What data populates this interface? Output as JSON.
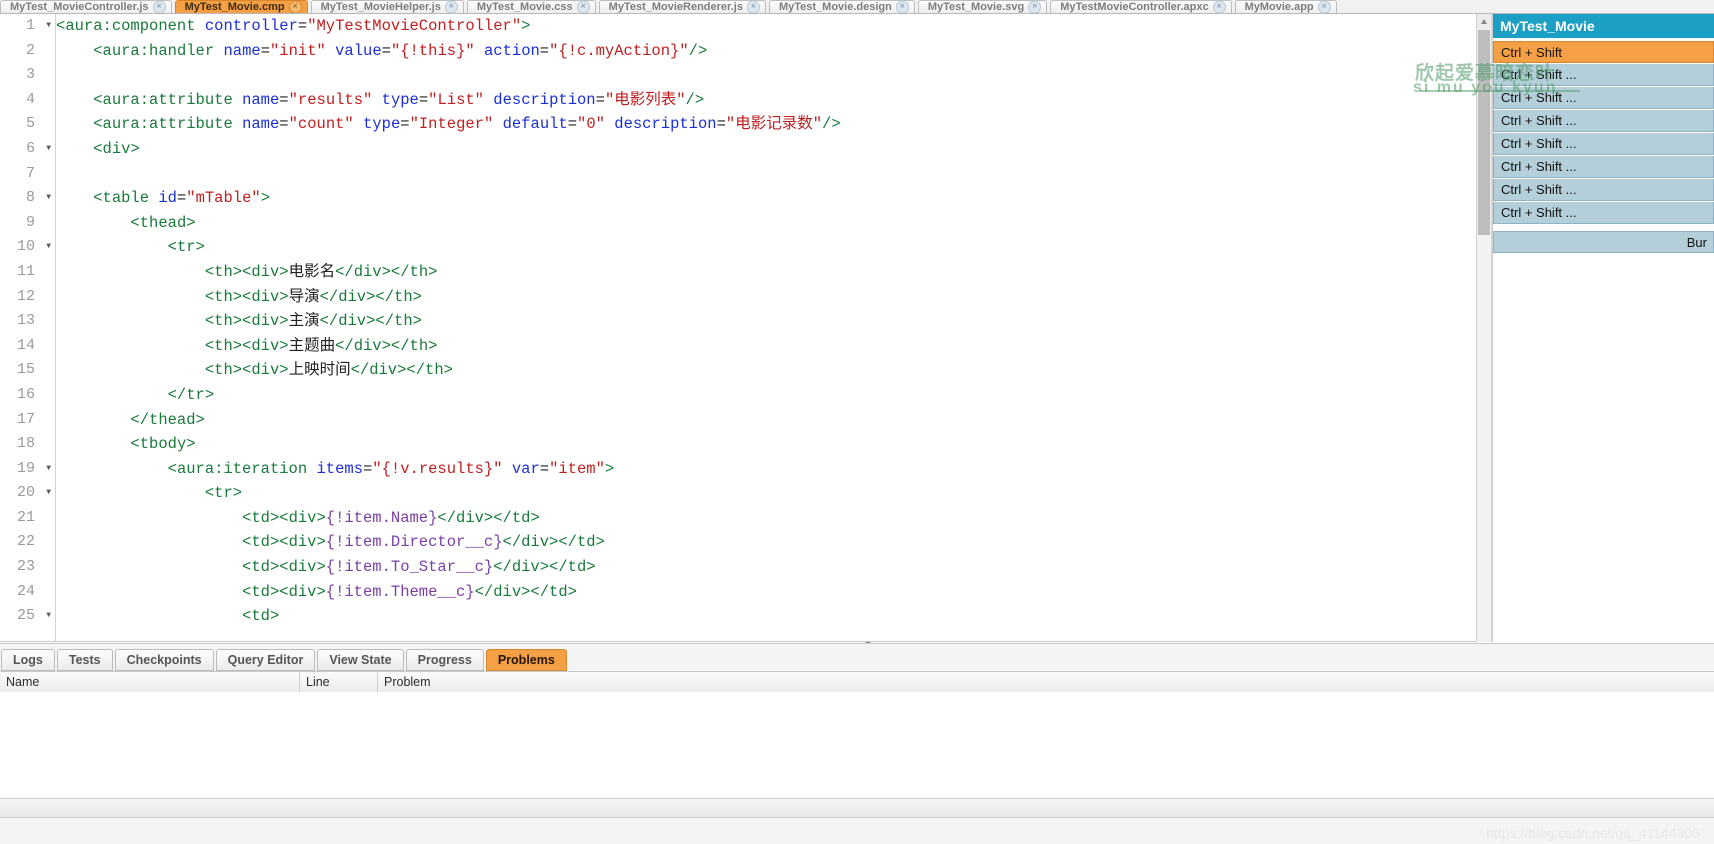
{
  "tabs": [
    {
      "label": "MyTest_MovieController.js",
      "active": false
    },
    {
      "label": "MyTest_Movie.cmp",
      "active": true
    },
    {
      "label": "MyTest_MovieHelper.js",
      "active": false
    },
    {
      "label": "MyTest_Movie.css",
      "active": false
    },
    {
      "label": "MyTest_MovieRenderer.js",
      "active": false
    },
    {
      "label": "MyTest_Movie.design",
      "active": false
    },
    {
      "label": "MyTest_Movie.svg",
      "active": false
    },
    {
      "label": "MyTestMovieController.apxc",
      "active": false
    },
    {
      "label": "MyMovie.app",
      "active": false
    }
  ],
  "tab_close_glyph": "×",
  "editor": {
    "lines": [
      {
        "n": 1,
        "fold": true,
        "indent": 0,
        "parts": [
          {
            "t": "punct",
            "s": "<"
          },
          {
            "t": "tag",
            "s": "aura:component"
          },
          {
            "t": "plain",
            "s": " "
          },
          {
            "t": "attr",
            "s": "controller"
          },
          {
            "t": "plain",
            "s": "="
          },
          {
            "t": "val",
            "s": "\"MyTestMovieController\""
          },
          {
            "t": "punct",
            "s": ">"
          }
        ]
      },
      {
        "n": 2,
        "fold": false,
        "indent": 1,
        "parts": [
          {
            "t": "punct",
            "s": "<"
          },
          {
            "t": "tag",
            "s": "aura:handler"
          },
          {
            "t": "plain",
            "s": " "
          },
          {
            "t": "attr",
            "s": "name"
          },
          {
            "t": "plain",
            "s": "="
          },
          {
            "t": "val",
            "s": "\"init\""
          },
          {
            "t": "plain",
            "s": " "
          },
          {
            "t": "attr",
            "s": "value"
          },
          {
            "t": "plain",
            "s": "="
          },
          {
            "t": "val",
            "s": "\"{!this}\""
          },
          {
            "t": "plain",
            "s": " "
          },
          {
            "t": "attr",
            "s": "action"
          },
          {
            "t": "plain",
            "s": "="
          },
          {
            "t": "val",
            "s": "\"{!c.myAction}\""
          },
          {
            "t": "punct",
            "s": "/>"
          }
        ]
      },
      {
        "n": 3,
        "fold": false,
        "indent": 0,
        "parts": []
      },
      {
        "n": 4,
        "fold": false,
        "indent": 1,
        "parts": [
          {
            "t": "punct",
            "s": "<"
          },
          {
            "t": "tag",
            "s": "aura:attribute"
          },
          {
            "t": "plain",
            "s": " "
          },
          {
            "t": "attr",
            "s": "name"
          },
          {
            "t": "plain",
            "s": "="
          },
          {
            "t": "val",
            "s": "\"results\""
          },
          {
            "t": "plain",
            "s": " "
          },
          {
            "t": "attr",
            "s": "type"
          },
          {
            "t": "plain",
            "s": "="
          },
          {
            "t": "val",
            "s": "\"List\""
          },
          {
            "t": "plain",
            "s": " "
          },
          {
            "t": "attr",
            "s": "description"
          },
          {
            "t": "plain",
            "s": "="
          },
          {
            "t": "val",
            "s": "\"电影列表\""
          },
          {
            "t": "punct",
            "s": "/>"
          }
        ]
      },
      {
        "n": 5,
        "fold": false,
        "indent": 1,
        "parts": [
          {
            "t": "punct",
            "s": "<"
          },
          {
            "t": "tag",
            "s": "aura:attribute"
          },
          {
            "t": "plain",
            "s": " "
          },
          {
            "t": "attr",
            "s": "name"
          },
          {
            "t": "plain",
            "s": "="
          },
          {
            "t": "val",
            "s": "\"count\""
          },
          {
            "t": "plain",
            "s": " "
          },
          {
            "t": "attr",
            "s": "type"
          },
          {
            "t": "plain",
            "s": "="
          },
          {
            "t": "val",
            "s": "\"Integer\""
          },
          {
            "t": "plain",
            "s": " "
          },
          {
            "t": "attr",
            "s": "default"
          },
          {
            "t": "plain",
            "s": "="
          },
          {
            "t": "val",
            "s": "\"0\""
          },
          {
            "t": "plain",
            "s": " "
          },
          {
            "t": "attr",
            "s": "description"
          },
          {
            "t": "plain",
            "s": "="
          },
          {
            "t": "val",
            "s": "\"电影记录数\""
          },
          {
            "t": "punct",
            "s": "/>"
          }
        ]
      },
      {
        "n": 6,
        "fold": true,
        "indent": 1,
        "parts": [
          {
            "t": "punct",
            "s": "<"
          },
          {
            "t": "tag",
            "s": "div"
          },
          {
            "t": "punct",
            "s": ">"
          }
        ]
      },
      {
        "n": 7,
        "fold": false,
        "indent": 0,
        "parts": []
      },
      {
        "n": 8,
        "fold": true,
        "indent": 1,
        "parts": [
          {
            "t": "punct",
            "s": "<"
          },
          {
            "t": "tag",
            "s": "table"
          },
          {
            "t": "plain",
            "s": " "
          },
          {
            "t": "attr",
            "s": "id"
          },
          {
            "t": "plain",
            "s": "="
          },
          {
            "t": "val",
            "s": "\"mTable\""
          },
          {
            "t": "punct",
            "s": ">"
          }
        ]
      },
      {
        "n": 9,
        "fold": false,
        "indent": 2,
        "parts": [
          {
            "t": "punct",
            "s": "<"
          },
          {
            "t": "tag",
            "s": "thead"
          },
          {
            "t": "punct",
            "s": ">"
          }
        ]
      },
      {
        "n": 10,
        "fold": true,
        "indent": 3,
        "parts": [
          {
            "t": "punct",
            "s": "<"
          },
          {
            "t": "tag",
            "s": "tr"
          },
          {
            "t": "punct",
            "s": ">"
          }
        ]
      },
      {
        "n": 11,
        "fold": false,
        "indent": 4,
        "parts": [
          {
            "t": "punct",
            "s": "<"
          },
          {
            "t": "tag",
            "s": "th"
          },
          {
            "t": "punct",
            "s": "><"
          },
          {
            "t": "tag",
            "s": "div"
          },
          {
            "t": "punct",
            "s": ">"
          },
          {
            "t": "plain",
            "s": "电影名"
          },
          {
            "t": "punct",
            "s": "</"
          },
          {
            "t": "tag",
            "s": "div"
          },
          {
            "t": "punct",
            "s": "></"
          },
          {
            "t": "tag",
            "s": "th"
          },
          {
            "t": "punct",
            "s": ">"
          }
        ]
      },
      {
        "n": 12,
        "fold": false,
        "indent": 4,
        "parts": [
          {
            "t": "punct",
            "s": "<"
          },
          {
            "t": "tag",
            "s": "th"
          },
          {
            "t": "punct",
            "s": "><"
          },
          {
            "t": "tag",
            "s": "div"
          },
          {
            "t": "punct",
            "s": ">"
          },
          {
            "t": "plain",
            "s": "导演"
          },
          {
            "t": "punct",
            "s": "</"
          },
          {
            "t": "tag",
            "s": "div"
          },
          {
            "t": "punct",
            "s": "></"
          },
          {
            "t": "tag",
            "s": "th"
          },
          {
            "t": "punct",
            "s": ">"
          }
        ]
      },
      {
        "n": 13,
        "fold": false,
        "indent": 4,
        "parts": [
          {
            "t": "punct",
            "s": "<"
          },
          {
            "t": "tag",
            "s": "th"
          },
          {
            "t": "punct",
            "s": "><"
          },
          {
            "t": "tag",
            "s": "div"
          },
          {
            "t": "punct",
            "s": ">"
          },
          {
            "t": "plain",
            "s": "主演"
          },
          {
            "t": "punct",
            "s": "</"
          },
          {
            "t": "tag",
            "s": "div"
          },
          {
            "t": "punct",
            "s": "></"
          },
          {
            "t": "tag",
            "s": "th"
          },
          {
            "t": "punct",
            "s": ">"
          }
        ]
      },
      {
        "n": 14,
        "fold": false,
        "indent": 4,
        "parts": [
          {
            "t": "punct",
            "s": "<"
          },
          {
            "t": "tag",
            "s": "th"
          },
          {
            "t": "punct",
            "s": "><"
          },
          {
            "t": "tag",
            "s": "div"
          },
          {
            "t": "punct",
            "s": ">"
          },
          {
            "t": "plain",
            "s": "主题曲"
          },
          {
            "t": "punct",
            "s": "</"
          },
          {
            "t": "tag",
            "s": "div"
          },
          {
            "t": "punct",
            "s": "></"
          },
          {
            "t": "tag",
            "s": "th"
          },
          {
            "t": "punct",
            "s": ">"
          }
        ]
      },
      {
        "n": 15,
        "fold": false,
        "indent": 4,
        "parts": [
          {
            "t": "punct",
            "s": "<"
          },
          {
            "t": "tag",
            "s": "th"
          },
          {
            "t": "punct",
            "s": "><"
          },
          {
            "t": "tag",
            "s": "div"
          },
          {
            "t": "punct",
            "s": ">"
          },
          {
            "t": "plain",
            "s": "上映时间"
          },
          {
            "t": "punct",
            "s": "</"
          },
          {
            "t": "tag",
            "s": "div"
          },
          {
            "t": "punct",
            "s": "></"
          },
          {
            "t": "tag",
            "s": "th"
          },
          {
            "t": "punct",
            "s": ">"
          }
        ]
      },
      {
        "n": 16,
        "fold": false,
        "indent": 3,
        "parts": [
          {
            "t": "punct",
            "s": "</"
          },
          {
            "t": "tag",
            "s": "tr"
          },
          {
            "t": "punct",
            "s": ">"
          }
        ]
      },
      {
        "n": 17,
        "fold": false,
        "indent": 2,
        "parts": [
          {
            "t": "punct",
            "s": "</"
          },
          {
            "t": "tag",
            "s": "thead"
          },
          {
            "t": "punct",
            "s": ">"
          }
        ]
      },
      {
        "n": 18,
        "fold": false,
        "indent": 2,
        "parts": [
          {
            "t": "punct",
            "s": "<"
          },
          {
            "t": "tag",
            "s": "tbody"
          },
          {
            "t": "punct",
            "s": ">"
          }
        ]
      },
      {
        "n": 19,
        "fold": true,
        "indent": 3,
        "parts": [
          {
            "t": "punct",
            "s": "<"
          },
          {
            "t": "tag",
            "s": "aura:iteration"
          },
          {
            "t": "plain",
            "s": " "
          },
          {
            "t": "attr",
            "s": "items"
          },
          {
            "t": "plain",
            "s": "="
          },
          {
            "t": "val",
            "s": "\"{!v.results}\""
          },
          {
            "t": "plain",
            "s": " "
          },
          {
            "t": "attr",
            "s": "var"
          },
          {
            "t": "plain",
            "s": "="
          },
          {
            "t": "val",
            "s": "\"item\""
          },
          {
            "t": "punct",
            "s": ">"
          }
        ]
      },
      {
        "n": 20,
        "fold": true,
        "indent": 4,
        "parts": [
          {
            "t": "punct",
            "s": "<"
          },
          {
            "t": "tag",
            "s": "tr"
          },
          {
            "t": "punct",
            "s": ">"
          }
        ]
      },
      {
        "n": 21,
        "fold": false,
        "indent": 5,
        "parts": [
          {
            "t": "punct",
            "s": "<"
          },
          {
            "t": "tag",
            "s": "td"
          },
          {
            "t": "punct",
            "s": "><"
          },
          {
            "t": "tag",
            "s": "div"
          },
          {
            "t": "punct",
            "s": ">"
          },
          {
            "t": "expr",
            "s": "{!item.Name}"
          },
          {
            "t": "punct",
            "s": "</"
          },
          {
            "t": "tag",
            "s": "div"
          },
          {
            "t": "punct",
            "s": "></"
          },
          {
            "t": "tag",
            "s": "td"
          },
          {
            "t": "punct",
            "s": ">"
          }
        ]
      },
      {
        "n": 22,
        "fold": false,
        "indent": 5,
        "parts": [
          {
            "t": "punct",
            "s": "<"
          },
          {
            "t": "tag",
            "s": "td"
          },
          {
            "t": "punct",
            "s": "><"
          },
          {
            "t": "tag",
            "s": "div"
          },
          {
            "t": "punct",
            "s": ">"
          },
          {
            "t": "expr",
            "s": "{!item.Director__c}"
          },
          {
            "t": "punct",
            "s": "</"
          },
          {
            "t": "tag",
            "s": "div"
          },
          {
            "t": "punct",
            "s": "></"
          },
          {
            "t": "tag",
            "s": "td"
          },
          {
            "t": "punct",
            "s": ">"
          }
        ]
      },
      {
        "n": 23,
        "fold": false,
        "indent": 5,
        "parts": [
          {
            "t": "punct",
            "s": "<"
          },
          {
            "t": "tag",
            "s": "td"
          },
          {
            "t": "punct",
            "s": "><"
          },
          {
            "t": "tag",
            "s": "div"
          },
          {
            "t": "punct",
            "s": ">"
          },
          {
            "t": "expr",
            "s": "{!item.To_Star__c}"
          },
          {
            "t": "punct",
            "s": "</"
          },
          {
            "t": "tag",
            "s": "div"
          },
          {
            "t": "punct",
            "s": "></"
          },
          {
            "t": "tag",
            "s": "td"
          },
          {
            "t": "punct",
            "s": ">"
          }
        ]
      },
      {
        "n": 24,
        "fold": false,
        "indent": 5,
        "parts": [
          {
            "t": "punct",
            "s": "<"
          },
          {
            "t": "tag",
            "s": "td"
          },
          {
            "t": "punct",
            "s": "><"
          },
          {
            "t": "tag",
            "s": "div"
          },
          {
            "t": "punct",
            "s": ">"
          },
          {
            "t": "expr",
            "s": "{!item.Theme__c}"
          },
          {
            "t": "punct",
            "s": "</"
          },
          {
            "t": "tag",
            "s": "div"
          },
          {
            "t": "punct",
            "s": "></"
          },
          {
            "t": "tag",
            "s": "td"
          },
          {
            "t": "punct",
            "s": ">"
          }
        ]
      },
      {
        "n": 25,
        "fold": true,
        "indent": 5,
        "parts": [
          {
            "t": "punct",
            "s": "<"
          },
          {
            "t": "tag",
            "s": "td"
          },
          {
            "t": "punct",
            "s": ">"
          }
        ]
      }
    ]
  },
  "right_panel": {
    "header": "MyTest_Movie",
    "items": [
      "Ctrl + Shift",
      "Ctrl + Shift ...",
      "Ctrl + Shift ...",
      "Ctrl + Shift ...",
      "Ctrl + Shift ...",
      "Ctrl + Shift ...",
      "Ctrl + Shift ...",
      "Ctrl + Shift ..."
    ],
    "footer": "Bur"
  },
  "watermark": {
    "chinese": "欣起爱慕暗恋叶",
    "pinyin": "si mu you kyun",
    "url": "https://blog.csdn.net/qq_41144305"
  },
  "bottom_panel": {
    "tabs": [
      {
        "label": "Logs",
        "active": false
      },
      {
        "label": "Tests",
        "active": false
      },
      {
        "label": "Checkpoints",
        "active": false
      },
      {
        "label": "Query Editor",
        "active": false
      },
      {
        "label": "View State",
        "active": false
      },
      {
        "label": "Progress",
        "active": false
      },
      {
        "label": "Problems",
        "active": true
      }
    ],
    "columns": [
      "Name",
      "Line",
      "Problem"
    ],
    "rows": []
  }
}
